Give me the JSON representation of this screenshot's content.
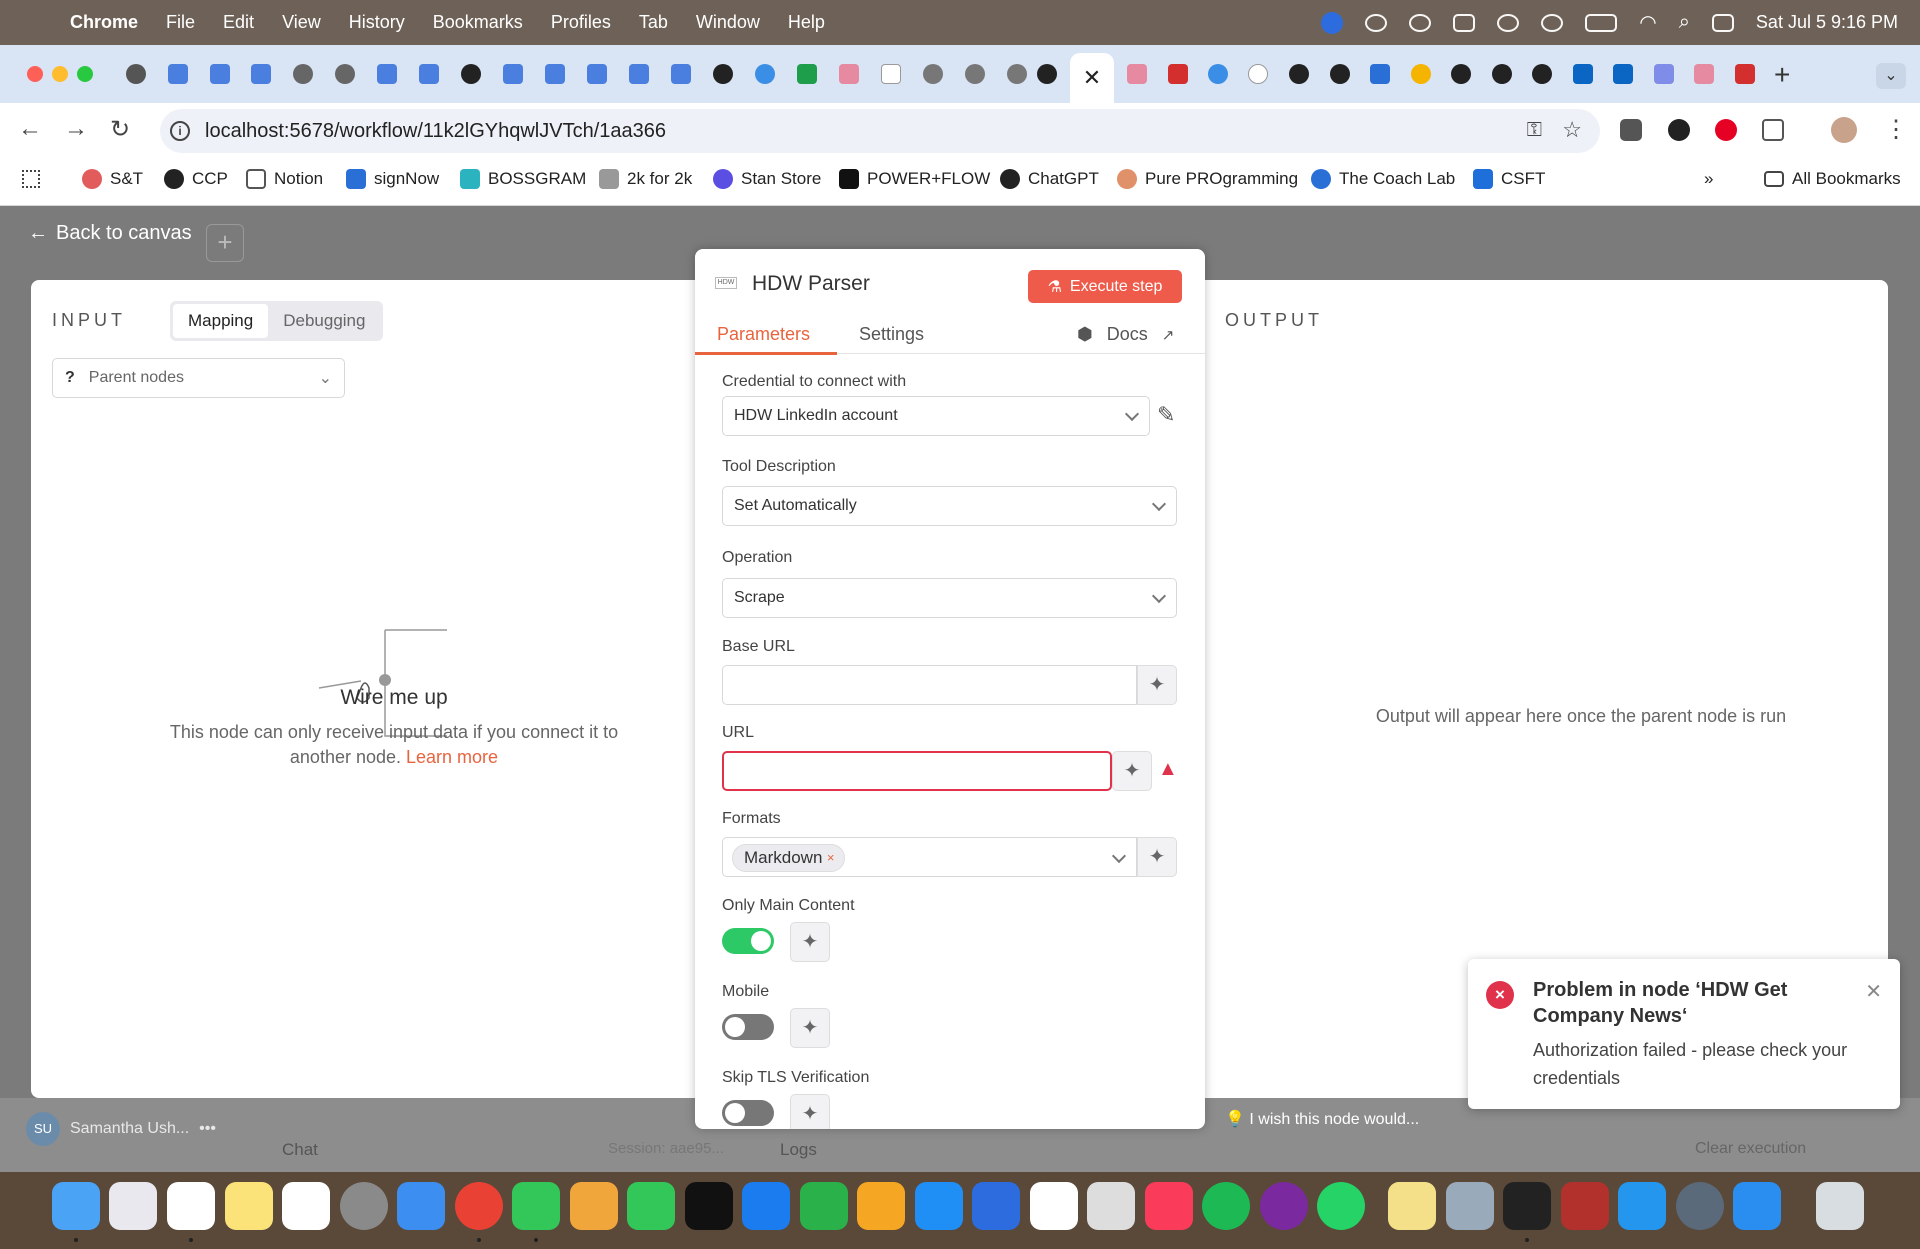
{
  "menubar": {
    "app": "Chrome",
    "items": [
      "File",
      "Edit",
      "View",
      "History",
      "Bookmarks",
      "Profiles",
      "Tab",
      "Window",
      "Help"
    ],
    "datetime": "Sat Jul 5  9:16 PM"
  },
  "browser": {
    "url": "localhost:5678/workflow/11k2lGYhqwlJVTch/1aa366",
    "active_tab_close": "✕",
    "new_tab": "+"
  },
  "bookmarks": [
    {
      "label": "S&T",
      "color": "#e25c5c"
    },
    {
      "label": "CCP",
      "color": "#222222"
    },
    {
      "label": "Notion",
      "color": "#555555"
    },
    {
      "label": "signNow",
      "color": "#2a6fd6"
    },
    {
      "label": "BOSSGRAM",
      "color": "#2bb3c0"
    },
    {
      "label": "2k for 2k",
      "color": "#777777"
    },
    {
      "label": "Stan Store",
      "color": "#5b4ee3"
    },
    {
      "label": "POWER+FLOW",
      "color": "#111111"
    },
    {
      "label": "ChatGPT",
      "color": "#222222"
    },
    {
      "label": "Pure PROgramming",
      "color": "#e0916a"
    },
    {
      "label": "The Coach Lab",
      "color": "#2a6fd6"
    },
    {
      "label": "CSFT",
      "color": "#1e6fd9"
    }
  ],
  "bookmarks_all": "All Bookmarks",
  "app": {
    "back": "Back to canvas",
    "input": {
      "title": "INPUT",
      "mode_mapping": "Mapping",
      "mode_debugging": "Debugging",
      "parent_nodes": "Parent nodes",
      "empty_title": "Wire me up",
      "empty_desc": "This node can only receive input data if you connect it to another node.",
      "learn_more": "Learn more"
    },
    "output": {
      "title": "OUTPUT",
      "message": "Output will appear here once the parent node is run"
    },
    "node": {
      "logo": "HDW",
      "title": "HDW Parser",
      "execute": "Execute step",
      "tab_parameters": "Parameters",
      "tab_settings": "Settings",
      "docs": "Docs",
      "credential_label": "Credential to connect with",
      "credential_value": "HDW LinkedIn account",
      "tool_desc_label": "Tool Description",
      "tool_desc_value": "Set Automatically",
      "operation_label": "Operation",
      "operation_value": "Scrape",
      "base_url_label": "Base URL",
      "url_label": "URL",
      "formats_label": "Formats",
      "formats_chip": "Markdown",
      "only_main_label": "Only Main Content",
      "only_main_on": true,
      "mobile_label": "Mobile",
      "mobile_on": false,
      "skip_tls_label": "Skip TLS Verification",
      "skip_tls_on": false
    },
    "bottom": {
      "user": "Samantha Ush...",
      "user_initials": "SU",
      "chat": "Chat",
      "session": "Session: aae95...",
      "logs": "Logs",
      "clear": "Clear execution",
      "wish": "I wish this node would..."
    },
    "toast": {
      "title": "Problem in node ‘HDW Get Company News‘",
      "message": "Authorization failed - please check your credentials"
    }
  },
  "colors": {
    "accent": "#e8643f",
    "execute": "#ef5b4b",
    "toggle_on": "#2ec967",
    "error": "#e0324b"
  }
}
